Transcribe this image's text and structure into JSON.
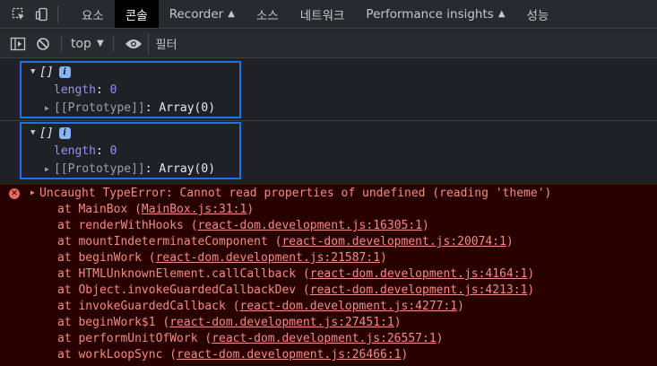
{
  "tabs": [
    {
      "label": "요소"
    },
    {
      "label": "콘솔",
      "active": true
    },
    {
      "label": "Recorder",
      "experimental": true
    },
    {
      "label": "소스"
    },
    {
      "label": "네트워크"
    },
    {
      "label": "Performance insights",
      "experimental": true
    },
    {
      "label": "성능"
    }
  ],
  "toolbar": {
    "context": "top",
    "filter_placeholder": "필터"
  },
  "logs": [
    {
      "summary": "[]",
      "info": "i",
      "length_key": "length",
      "length_value": "0",
      "prototype_key": "[[Prototype]]",
      "prototype_value": "Array(0)"
    },
    {
      "summary": "[]",
      "info": "i",
      "length_key": "length",
      "length_value": "0",
      "prototype_key": "[[Prototype]]",
      "prototype_value": "Array(0)"
    }
  ],
  "error": {
    "icon": "error-circle-icon",
    "message": "Uncaught TypeError: Cannot read properties of undefined (reading 'theme')",
    "stack": [
      {
        "fn": "at MainBox (",
        "loc": "MainBox.js:31:1",
        "end": ")"
      },
      {
        "fn": "at renderWithHooks (",
        "loc": "react-dom.development.js:16305:1",
        "end": ")"
      },
      {
        "fn": "at mountIndeterminateComponent (",
        "loc": "react-dom.development.js:20074:1",
        "end": ")"
      },
      {
        "fn": "at beginWork (",
        "loc": "react-dom.development.js:21587:1",
        "end": ")"
      },
      {
        "fn": "at HTMLUnknownElement.callCallback (",
        "loc": "react-dom.development.js:4164:1",
        "end": ")"
      },
      {
        "fn": "at Object.invokeGuardedCallbackDev (",
        "loc": "react-dom.development.js:4213:1",
        "end": ")"
      },
      {
        "fn": "at invokeGuardedCallback (",
        "loc": "react-dom.development.js:4277:1",
        "end": ")"
      },
      {
        "fn": "at beginWork$1 (",
        "loc": "react-dom.development.js:27451:1",
        "end": ")"
      },
      {
        "fn": "at performUnitOfWork (",
        "loc": "react-dom.development.js:26557:1",
        "end": ")"
      },
      {
        "fn": "at workLoopSync (",
        "loc": "react-dom.development.js:26466:1",
        "end": ")"
      }
    ]
  },
  "colors": {
    "accent": "#1a73e8",
    "error_bg": "#290000",
    "error_text": "#f28b82",
    "property": "#9d8cf6"
  }
}
